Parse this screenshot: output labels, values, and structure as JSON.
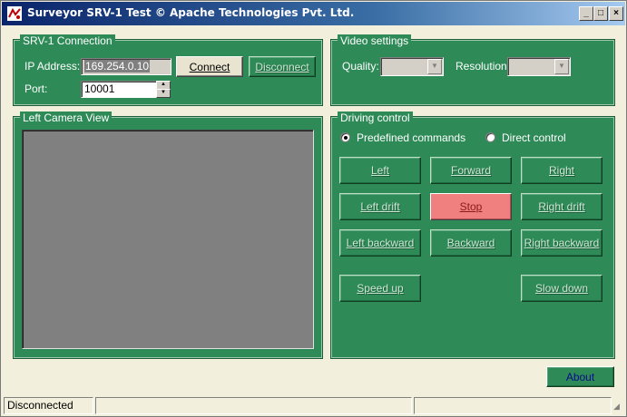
{
  "window": {
    "title": "Surveyor SRV-1 Test © Apache Technologies Pvt. Ltd.",
    "minimize_glyph": "_",
    "maximize_glyph": "□",
    "close_glyph": "×"
  },
  "connection": {
    "group_label": "SRV-1 Connection",
    "ip_label": "IP Address:",
    "ip_value": "169.254.0.10",
    "port_label": "Port:",
    "port_value": "10001",
    "connect_label": "Connect",
    "disconnect_label": "Disconnect"
  },
  "video": {
    "group_label": "Video settings",
    "quality_label": "Quality:",
    "quality_value": "",
    "resolution_label": "Resolution:",
    "resolution_value": ""
  },
  "camera": {
    "group_label": "Left Camera View"
  },
  "driving": {
    "group_label": "Driving control",
    "mode_predefined": "Predefined commands",
    "mode_direct": "Direct control",
    "selected_mode": "predefined",
    "buttons": {
      "left": "Left",
      "forward": "Forward",
      "right": "Right",
      "left_drift": "Left drift",
      "stop": "Stop",
      "right_drift": "Right drift",
      "left_backward": "Left backward",
      "backward": "Backward",
      "right_backward": "Right backward",
      "speed_up": "Speed up",
      "slow_down": "Slow down"
    }
  },
  "about_label": "About",
  "status": {
    "pane1": "Disconnected",
    "pane2": "",
    "pane3": ""
  },
  "colors": {
    "panel_green": "#2e8b57",
    "stop_button": "#f08080",
    "titlebar_start": "#0a246a"
  }
}
